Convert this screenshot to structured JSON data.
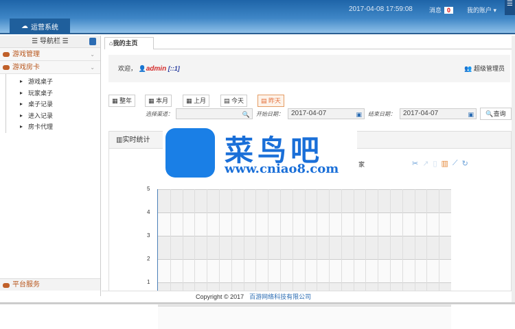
{
  "header": {
    "system_tab": "运营系统",
    "datetime": "2017-04-08 17:59:08",
    "messages_label": "消息",
    "messages_count": "0",
    "account": "我的账户 ▾"
  },
  "sidebar": {
    "title": "☰ 导航栏 ☰",
    "groups": [
      {
        "label": "游戏管理"
      },
      {
        "label": "游戏房卡",
        "items": [
          "游戏桌子",
          "玩家桌子",
          "桌子记录",
          "进入记录",
          "房卡代理"
        ]
      }
    ],
    "footer_group": "平台服务"
  },
  "tabs": {
    "home": "我的主页"
  },
  "welcome": {
    "prefix": "欢迎，",
    "user": "admin",
    "ip": "[::1]",
    "role": "超级管理员"
  },
  "filters": {
    "buttons": [
      "整年",
      "本月",
      "上月",
      "今天",
      "昨天"
    ],
    "active": "昨天",
    "channel_label": "选择渠道：",
    "channel_value": "",
    "start_label": "开始日期：",
    "start_value": "2017-04-07",
    "end_label": "结束日期：",
    "end_value": "2017-04-07",
    "query": "查询"
  },
  "panel": {
    "title": "实时统计",
    "legend": "家"
  },
  "watermark": {
    "name": "菜鸟吧",
    "url": "www.cniao8.com"
  },
  "chart_data": {
    "type": "bar",
    "title": "",
    "xlabel": "",
    "ylabel": "",
    "ylim": [
      0,
      5
    ],
    "yticks": [
      "5",
      "4",
      "3",
      "2",
      "1"
    ],
    "categories": 24,
    "series": []
  },
  "footer": {
    "copyright": "Copyright © 2017",
    "company": "百游网络科技有限公司"
  }
}
